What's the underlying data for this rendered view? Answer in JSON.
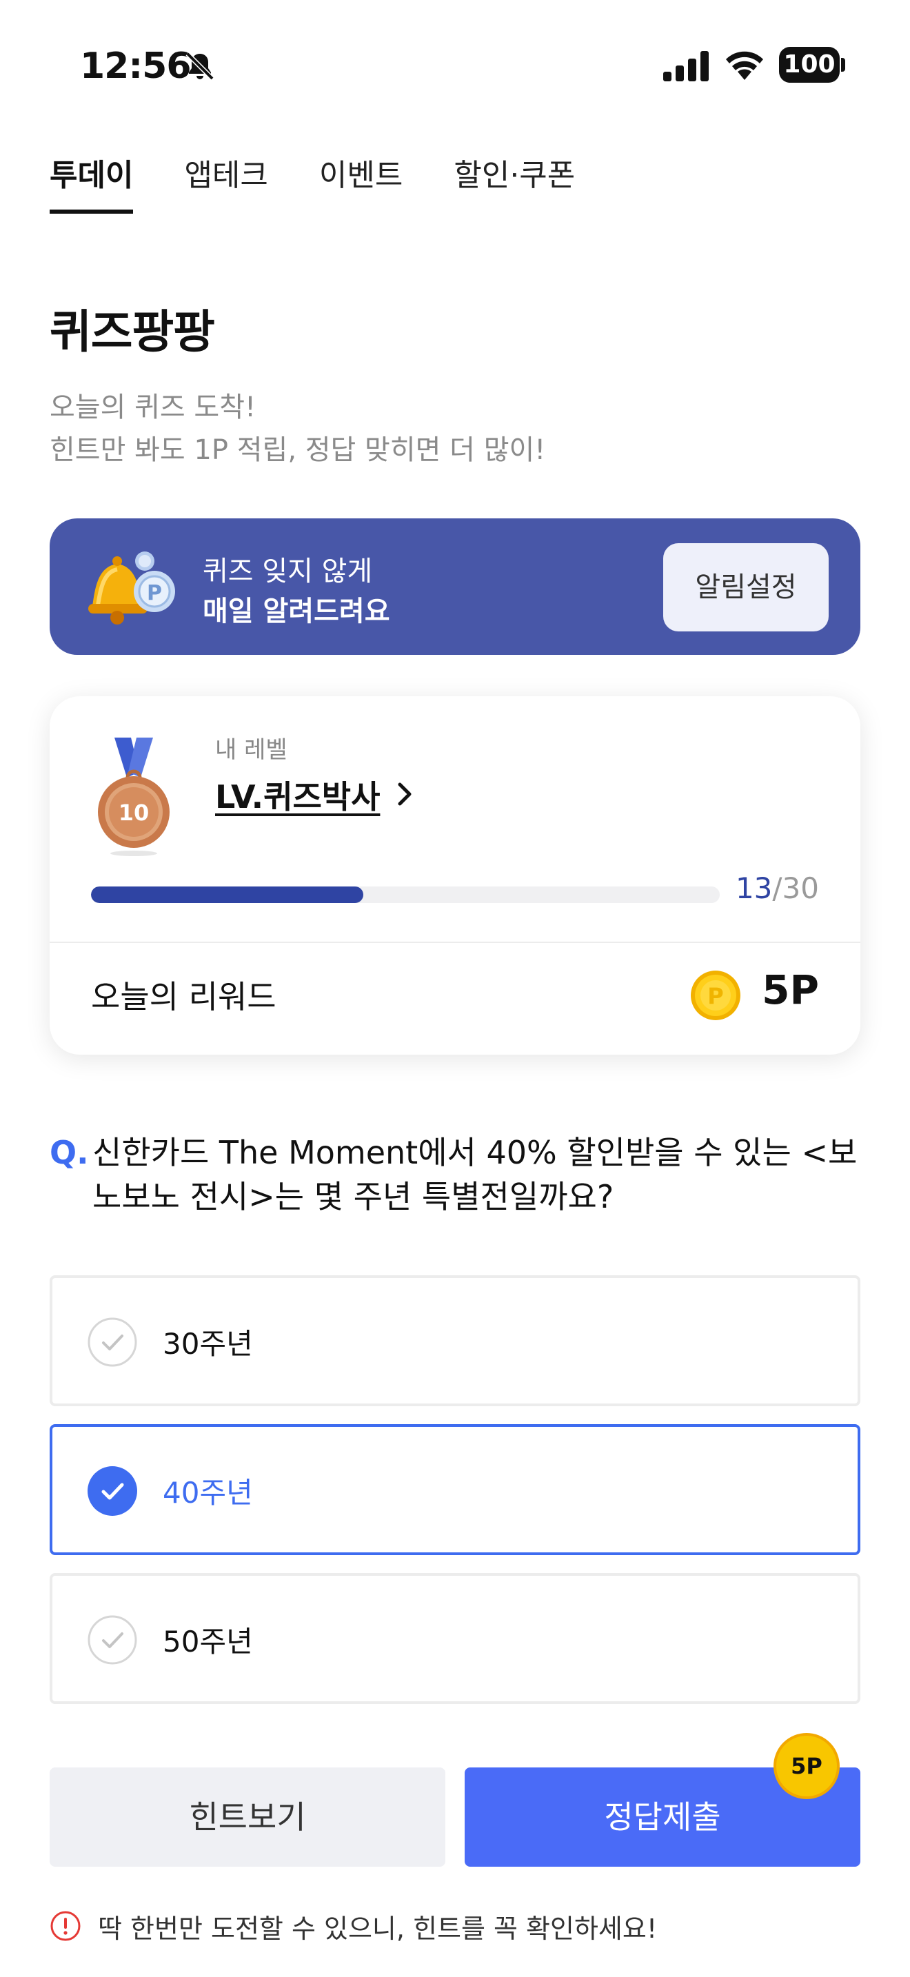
{
  "status_bar": {
    "time": "12:56",
    "battery": "100",
    "icons": [
      "bell-slash-icon",
      "cellular-signal-icon",
      "wifi-icon",
      "battery-icon"
    ]
  },
  "tabs": [
    {
      "label": "투데이",
      "active": true
    },
    {
      "label": "앱테크",
      "active": false
    },
    {
      "label": "이벤트",
      "active": false
    },
    {
      "label": "할인·쿠폰",
      "active": false
    }
  ],
  "page": {
    "title": "퀴즈팡팡",
    "subtitle_line1": "오늘의 퀴즈 도착!",
    "subtitle_line2": "힌트만 봐도 1P 적립, 정답 맞히면 더 많이!"
  },
  "banner": {
    "line1": "퀴즈 잊지 않게",
    "line2": "매일 알려드려요",
    "button_label": "알림설정",
    "background": "#4857a8"
  },
  "level_card": {
    "label": "내 레벨",
    "level_name": "LV.퀴즈박사",
    "medal_number": "10",
    "progress_current": "13",
    "progress_separator": "/",
    "progress_total": "30",
    "progress_fraction": 0.433,
    "reward_label": "오늘의 리워드",
    "reward_value": "5P",
    "coin_symbol": "P"
  },
  "question": {
    "prefix": "Q.",
    "text": "신한카드 The Moment에서 40% 할인받을 수 있는 <보노보노 전시>는 몇 주년 특별전일까요?"
  },
  "options": [
    {
      "label": "30주년",
      "selected": false
    },
    {
      "label": "40주년",
      "selected": true
    },
    {
      "label": "50주년",
      "selected": false
    }
  ],
  "actions": {
    "hint_label": "힌트보기",
    "submit_label": "정답제출",
    "submit_badge": "5P"
  },
  "warning": {
    "text": "딱 한번만 도전할 수 있으니, 힌트를 꼭 확인하세요!"
  },
  "colors": {
    "accent": "#3e6cf0",
    "submit": "#4a6bf7",
    "progress": "#2f44a3",
    "warning": "#e53935",
    "coin": "#f8c600"
  }
}
